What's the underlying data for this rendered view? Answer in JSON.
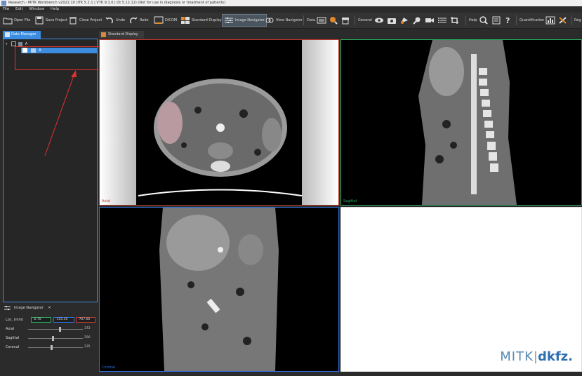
{
  "window": {
    "title": "Research - MITK Workbench v2022.10 (ITK 5.2.1 | VTK 9.1.0 | Qt 5.12.12) (Not for use in diagnosis or treatment of patients)"
  },
  "menu": [
    "File",
    "Edit",
    "Window",
    "Help"
  ],
  "toolbar": {
    "open_file": "Open File",
    "save_project": "Save Project",
    "close_project": "Close Project",
    "undo": "Undo",
    "redo": "Redo",
    "dicom": "DICOM",
    "standard_display": "Standard Display",
    "image_navigator": "Image Navigator",
    "view_navigator": "View Navigator",
    "data_label": "Data",
    "general_label": "General",
    "help_label": "Help",
    "quantification_label": "Quantification",
    "reg_label": "Reg"
  },
  "data_manager": {
    "tab_label": "Data Manager",
    "tree": [
      {
        "label": "A"
      },
      {
        "label": "A"
      }
    ]
  },
  "image_navigator": {
    "tab_label": "Image Navigator",
    "loc_label": "Loc. (mm)",
    "loc": [
      "-2.70",
      "-155.30",
      "-767.60"
    ],
    "rows": [
      {
        "label": "Axial",
        "value": "372",
        "fraction": 0.58
      },
      {
        "label": "Sagittal",
        "value": "256",
        "fraction": 0.46
      },
      {
        "label": "Coronal",
        "value": "235",
        "fraction": 0.43
      }
    ]
  },
  "display": {
    "tab_label": "Standard Display",
    "views": {
      "axial": "Axial",
      "sagittal": "Sagittal",
      "coronal": "Coronal"
    }
  },
  "logo": {
    "left": "MITK",
    "right": "dkfz."
  },
  "colors": {
    "accent": "#3c8de0",
    "axial": "#c0392b",
    "sagittal": "#27ae60",
    "coronal": "#2e6fd8",
    "annotation": "#e53030"
  }
}
